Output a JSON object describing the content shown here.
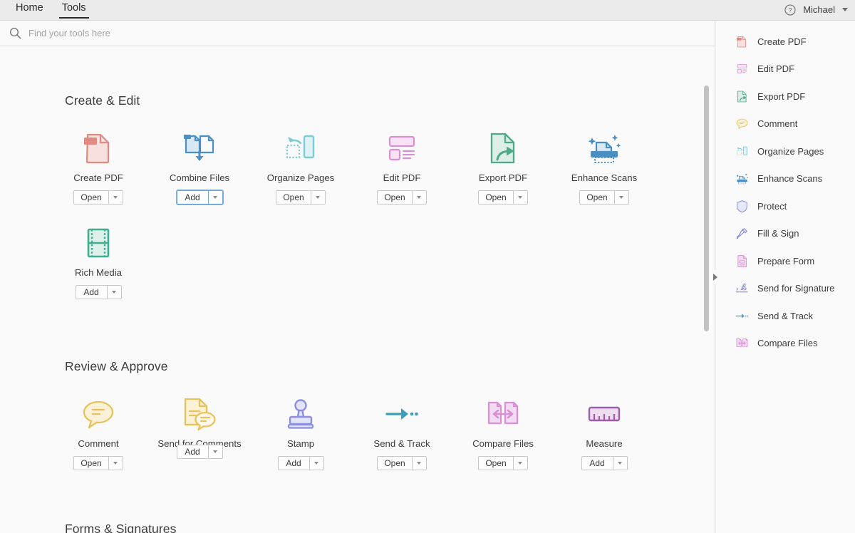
{
  "header": {
    "tabs": [
      {
        "label": "Home",
        "active": false
      },
      {
        "label": "Tools",
        "active": true
      }
    ],
    "help_icon": "help-circle-icon",
    "username": "Michael",
    "user_caret_icon": "chevron-down-icon"
  },
  "search": {
    "icon": "search-icon",
    "placeholder": "Find your tools here",
    "value": ""
  },
  "sections": [
    {
      "title": "Create & Edit",
      "tools": [
        {
          "label": "Create PDF",
          "icon": "create-pdf-icon",
          "button": "Open",
          "focused": false
        },
        {
          "label": "Combine Files",
          "icon": "combine-files-icon",
          "button": "Add",
          "focused": true
        },
        {
          "label": "Organize Pages",
          "icon": "organize-pages-icon",
          "button": "Open",
          "focused": false
        },
        {
          "label": "Edit PDF",
          "icon": "edit-pdf-icon",
          "button": "Open",
          "focused": false
        },
        {
          "label": "Export PDF",
          "icon": "export-pdf-icon",
          "button": "Open",
          "focused": false
        },
        {
          "label": "Enhance Scans",
          "icon": "enhance-scans-icon",
          "button": "Open",
          "focused": false
        },
        {
          "label": "Rich Media",
          "icon": "rich-media-icon",
          "button": "Add",
          "focused": false
        }
      ]
    },
    {
      "title": "Review & Approve",
      "tools": [
        {
          "label": "Comment",
          "icon": "comment-icon",
          "button": "Open",
          "focused": false
        },
        {
          "label": "Send for Comments",
          "icon": "send-for-comments-icon",
          "button": "Add",
          "focused": false
        },
        {
          "label": "Stamp",
          "icon": "stamp-icon",
          "button": "Add",
          "focused": false
        },
        {
          "label": "Send & Track",
          "icon": "send-and-track-icon",
          "button": "Open",
          "focused": false
        },
        {
          "label": "Compare Files",
          "icon": "compare-files-icon",
          "button": "Open",
          "focused": false
        },
        {
          "label": "Measure",
          "icon": "measure-icon",
          "button": "Add",
          "focused": false
        }
      ]
    },
    {
      "title": "Forms & Signatures",
      "tools": []
    }
  ],
  "sidebar": {
    "collapse_icon": "collapse-panel-arrow-icon",
    "items": [
      {
        "label": "Create PDF",
        "icon": "create-pdf-icon"
      },
      {
        "label": "Edit PDF",
        "icon": "edit-pdf-icon"
      },
      {
        "label": "Export PDF",
        "icon": "export-pdf-icon"
      },
      {
        "label": "Comment",
        "icon": "comment-icon"
      },
      {
        "label": "Organize Pages",
        "icon": "organize-pages-icon"
      },
      {
        "label": "Enhance Scans",
        "icon": "enhance-scans-icon"
      },
      {
        "label": "Protect",
        "icon": "protect-shield-icon"
      },
      {
        "label": "Fill & Sign",
        "icon": "fill-and-sign-icon"
      },
      {
        "label": "Prepare Form",
        "icon": "prepare-form-icon"
      },
      {
        "label": "Send for Signature",
        "icon": "send-for-signature-icon"
      },
      {
        "label": "Send & Track",
        "icon": "send-and-track-icon"
      },
      {
        "label": "Compare Files",
        "icon": "compare-files-icon"
      }
    ]
  },
  "colors": {
    "create_pdf": "#e08a82",
    "combine_files": "#4a90c4",
    "organize_pages": "#7ecbd8",
    "edit_pdf": "#d98fd4",
    "export_pdf": "#4fa88a",
    "enhance_scans": "#4a8fc4",
    "rich_media": "#3fae93",
    "comment": "#e8c35c",
    "stamp": "#8b8fe0",
    "send_track": "#3d9cb8",
    "compare_files": "#d98fd4",
    "measure": "#9b5fa8",
    "protect": "#8b93d9",
    "fill_sign": "#7a7fd4",
    "accent_focus": "#7cb0e0",
    "text": "#3c3c3c",
    "topbar_bg": "#ebebeb",
    "page_bg": "#fafafa"
  }
}
